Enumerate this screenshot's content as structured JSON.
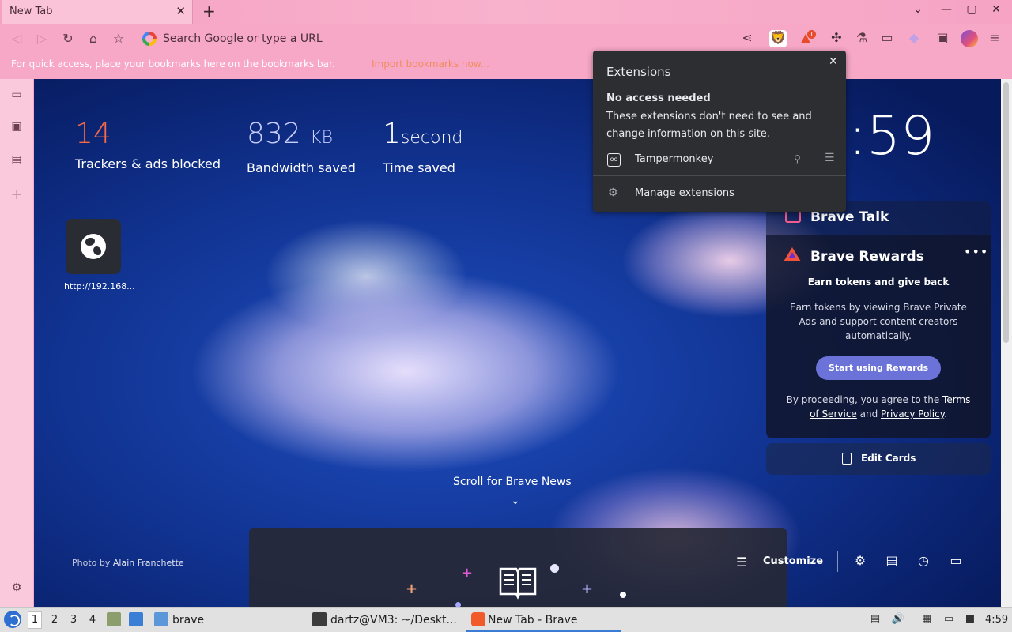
{
  "browser": {
    "tab": {
      "title": "New Tab",
      "close": "✕"
    },
    "new_tab": "+",
    "window_controls": {
      "dropdown": "⌄",
      "minimize": "—",
      "maximize": "▢",
      "close": "✕"
    },
    "omnibox": {
      "placeholder": "Search Google or type a URL"
    },
    "brave_shield_count": "1",
    "bookmarks_bar": {
      "hint": "For quick access, place your bookmarks here on the bookmarks bar.",
      "import": "Import bookmarks now..."
    }
  },
  "sidebar": {
    "items": [
      "talk-icon",
      "wallet-icon",
      "reading-list-icon",
      "add-icon"
    ],
    "settings": "settings-icon"
  },
  "ntp": {
    "stats": {
      "trackers": {
        "value": "14",
        "label": "Trackers & ads blocked"
      },
      "bandwidth": {
        "value": "832",
        "unit": "KB",
        "label": "Bandwidth saved"
      },
      "time": {
        "value": "1",
        "unit": "second",
        "label": "Time saved"
      }
    },
    "clock": ":59",
    "top_site": {
      "label": "http://192.168..."
    },
    "talk": {
      "title": "Brave Talk"
    },
    "rewards": {
      "title": "Brave Rewards",
      "more": "•••",
      "subtitle": "Earn tokens and give back",
      "description": "Earn tokens by viewing Brave Private Ads and support content creators automatically.",
      "button": "Start using Rewards",
      "legal_prefix": "By proceeding, you agree to the ",
      "terms": "Terms of Service",
      "and": " and ",
      "privacy": "Privacy Policy",
      "suffix": "."
    },
    "edit_cards": "Edit Cards",
    "scroll_news": "Scroll for Brave News",
    "photo_credit": {
      "prefix": "Photo by ",
      "name": "Alain Franchette"
    },
    "customize": "Customize"
  },
  "extensions_popup": {
    "title": "Extensions",
    "close": "✕",
    "section_heading": "No access needed",
    "section_description": "These extensions don't need to see and change information on this site.",
    "extension": {
      "name": "Tampermonkey",
      "icon": "oo"
    },
    "manage": "Manage extensions"
  },
  "taskbar": {
    "workspaces": [
      "1",
      "2",
      "3",
      "4"
    ],
    "apps": [
      {
        "label": "brave"
      },
      {
        "label": "dartz@VM3: ~/Deskt..."
      },
      {
        "label": "New Tab - Brave"
      }
    ],
    "time": "4:59"
  },
  "colors": {
    "accent_pink": "#f7a8c6",
    "tracker_orange": "#fb6845",
    "rewards_button": "#6b73d9",
    "popup_bg": "#2d2e31"
  }
}
